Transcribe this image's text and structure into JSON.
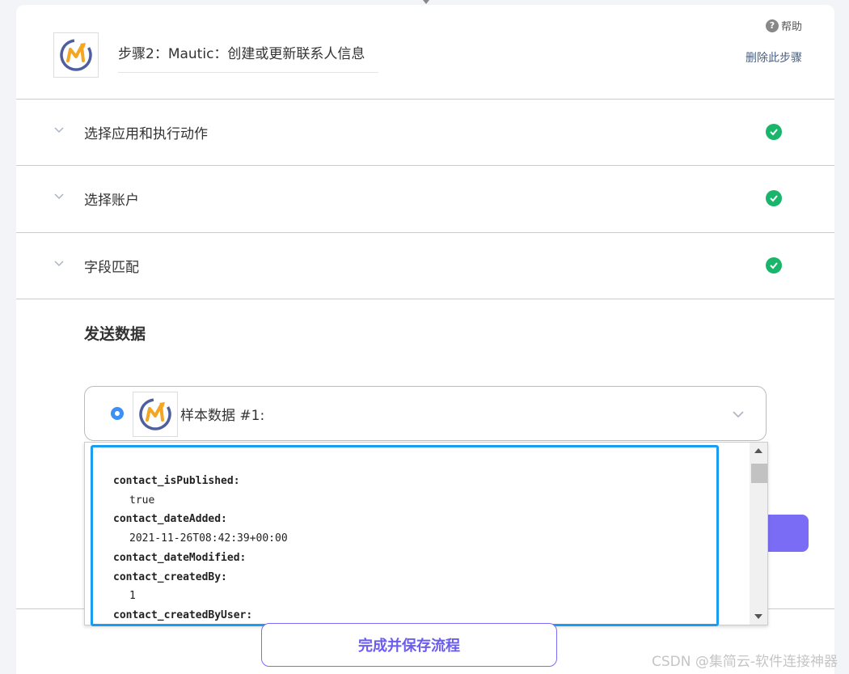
{
  "header": {
    "step_title": "步骤2：Mautic：创建或更新联系人信息",
    "help_label": "帮助",
    "delete_label": "删除此步骤"
  },
  "sections": [
    {
      "label": "选择应用和执行动作",
      "status": "complete"
    },
    {
      "label": "选择账户",
      "status": "complete"
    },
    {
      "label": "字段匹配",
      "status": "complete"
    }
  ],
  "send_data": {
    "title": "发送数据",
    "sample_label": "样本数据 #1:"
  },
  "dropdown": {
    "fields": [
      {
        "key": "contact_isPublished:",
        "value": "true"
      },
      {
        "key": "contact_dateAdded:",
        "value": "2021-11-26T08:42:39+00:00"
      },
      {
        "key": "contact_dateModified:",
        "value": ""
      },
      {
        "key": "contact_createdBy:",
        "value": "1"
      },
      {
        "key": "contact_createdByUser:",
        "value": ""
      }
    ]
  },
  "footer": {
    "finish_label": "完成并保存流程",
    "watermark": "CSDN @集简云-软件连接神器"
  },
  "colors": {
    "accent": "#7b6cf6",
    "success": "#18b56b",
    "highlight": "#1a9cf0",
    "radio": "#3d8ff5"
  }
}
